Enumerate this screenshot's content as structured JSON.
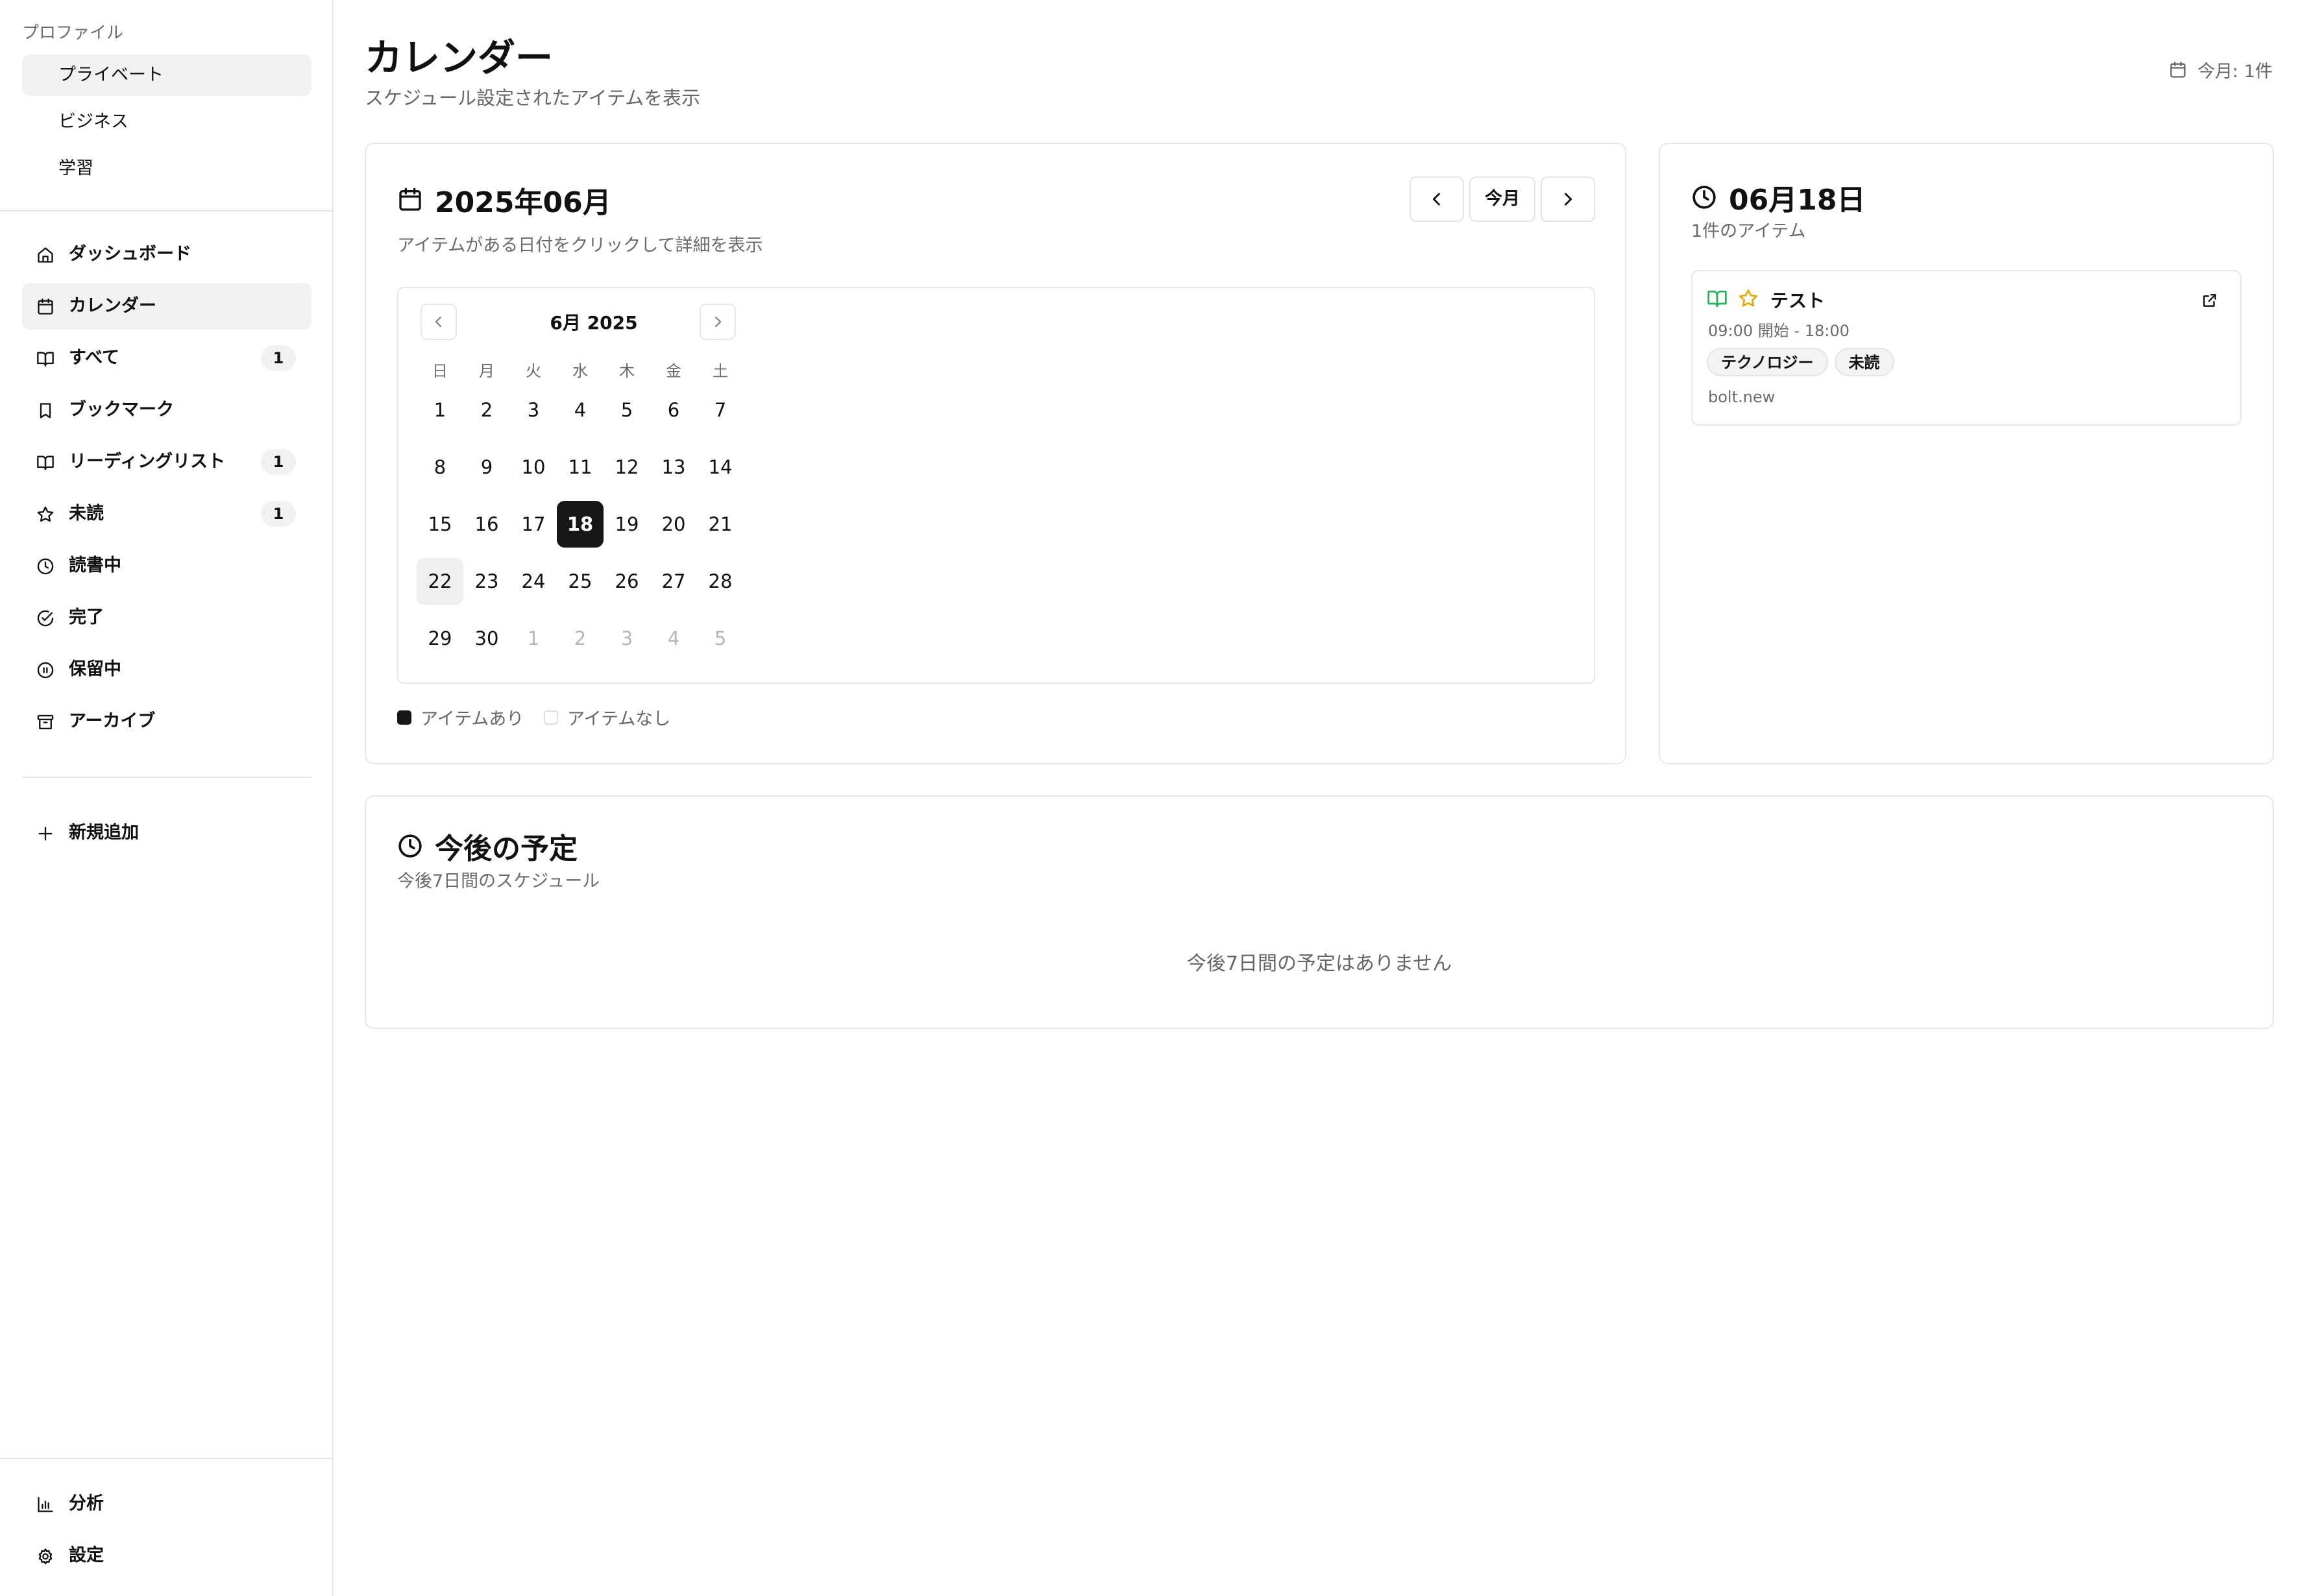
{
  "sidebar": {
    "profile_label": "プロファイル",
    "profiles": [
      {
        "label": "プライベート",
        "active": true
      },
      {
        "label": "ビジネス",
        "active": false
      },
      {
        "label": "学習",
        "active": false
      }
    ],
    "nav": [
      {
        "label": "ダッシュボード",
        "icon": "home-icon",
        "badge": ""
      },
      {
        "label": "カレンダー",
        "icon": "calendar-icon",
        "badge": "",
        "active": true
      },
      {
        "label": "すべて",
        "icon": "book-open-icon",
        "badge": "1"
      },
      {
        "label": "ブックマーク",
        "icon": "bookmark-icon",
        "badge": ""
      },
      {
        "label": "リーディングリスト",
        "icon": "book-open-icon",
        "badge": "1"
      },
      {
        "label": "未読",
        "icon": "star-icon",
        "badge": "1"
      },
      {
        "label": "読書中",
        "icon": "clock-icon",
        "badge": ""
      },
      {
        "label": "完了",
        "icon": "check-circle-icon",
        "badge": ""
      },
      {
        "label": "保留中",
        "icon": "pause-circle-icon",
        "badge": ""
      },
      {
        "label": "アーカイブ",
        "icon": "archive-icon",
        "badge": ""
      }
    ],
    "add_new": "新規追加",
    "analytics": "分析",
    "settings": "設定"
  },
  "header": {
    "title": "カレンダー",
    "subtitle": "スケジュール設定されたアイテムを表示",
    "month_count": "今月: 1件"
  },
  "calendar_card": {
    "title": "2025年06月",
    "subtitle": "アイテムがある日付をクリックして詳細を表示",
    "today_button": "今月",
    "caption": "6月 2025",
    "weekdays": [
      "日",
      "月",
      "火",
      "水",
      "木",
      "金",
      "土"
    ],
    "weeks": [
      [
        "1",
        "2",
        "3",
        "4",
        "5",
        "6",
        "7"
      ],
      [
        "8",
        "9",
        "10",
        "11",
        "12",
        "13",
        "14"
      ],
      [
        "15",
        "16",
        "17",
        "18",
        "19",
        "20",
        "21"
      ],
      [
        "22",
        "23",
        "24",
        "25",
        "26",
        "27",
        "28"
      ],
      [
        "29",
        "30",
        "1",
        "2",
        "3",
        "4",
        "5"
      ]
    ],
    "selected_day": "18",
    "today_day": "22",
    "legend_has": "アイテムあり",
    "legend_none": "アイテムなし"
  },
  "day_card": {
    "title": "06月18日",
    "subtitle": "1件のアイテム",
    "item": {
      "title": "テスト",
      "time": "09:00 開始 - 18:00",
      "tags": [
        "テクノロジー",
        "未読"
      ],
      "source": "bolt.new"
    }
  },
  "upcoming_card": {
    "title": "今後の予定",
    "subtitle": "今後7日間のスケジュール",
    "empty": "今後7日間の予定はありません"
  },
  "colors": {
    "accent_dark": "#171717",
    "book_icon_green": "#22b35a",
    "star_yellow": "#e6a800"
  }
}
